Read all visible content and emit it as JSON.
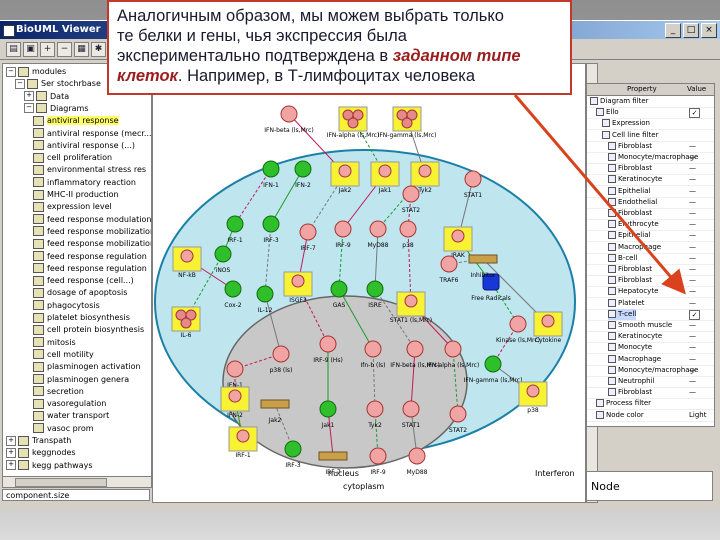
{
  "window": {
    "title": "BioUML Viewer",
    "controls": [
      "_",
      "□",
      "×"
    ]
  },
  "toolbar": {
    "buttons": [
      {
        "name": "open-icon",
        "glyph": "▤"
      },
      {
        "name": "save-icon",
        "glyph": "▣"
      },
      {
        "name": "zoom-in-icon",
        "glyph": "+"
      },
      {
        "name": "zoom-out-icon",
        "glyph": "−"
      },
      {
        "name": "layout-icon",
        "glyph": "▦"
      },
      {
        "name": "settings-icon",
        "glyph": "✱"
      },
      {
        "name": "help-icon",
        "glyph": "?"
      }
    ]
  },
  "callout": {
    "line1": "Аналогичным образом, мы можем выбрать только",
    "line2": "те белки и гены, чья экспрессия была",
    "line3_plain": "экспериментально подтверждена в ",
    "line3_emph": "заданном типе",
    "line4_emph": "клеток",
    "line4_plain": ". Например, в Т-лимфоцитах человека"
  },
  "tree": {
    "items": [
      {
        "label": "modules",
        "indent": 0,
        "exp": "−"
      },
      {
        "label": "Ser stochrbase",
        "indent": 1,
        "exp": "−"
      },
      {
        "label": "Data",
        "indent": 2,
        "exp": "+"
      },
      {
        "label": "Diagrams",
        "indent": 2,
        "exp": "−"
      },
      {
        "label": "antiviral response",
        "indent": 3,
        "exp": "",
        "selected": true
      },
      {
        "label": "antiviral response (mecr...)",
        "indent": 3,
        "exp": ""
      },
      {
        "label": "antiviral response (...)",
        "indent": 3,
        "exp": ""
      },
      {
        "label": "cell proliferation",
        "indent": 3,
        "exp": ""
      },
      {
        "label": "environmental stress res",
        "indent": 3,
        "exp": ""
      },
      {
        "label": "inflammatory reaction",
        "indent": 3,
        "exp": ""
      },
      {
        "label": "MHC-II production",
        "indent": 3,
        "exp": ""
      },
      {
        "label": "expression level",
        "indent": 3,
        "exp": ""
      },
      {
        "label": "feed response modulation...",
        "indent": 3,
        "exp": ""
      },
      {
        "label": "feed response mobilization..",
        "indent": 3,
        "exp": ""
      },
      {
        "label": "feed response mobilization",
        "indent": 3,
        "exp": ""
      },
      {
        "label": "feed response regulation",
        "indent": 3,
        "exp": ""
      },
      {
        "label": "feed response regulation",
        "indent": 3,
        "exp": ""
      },
      {
        "label": "feed response (cell...)",
        "indent": 3,
        "exp": ""
      },
      {
        "label": "dosage of apoptosis",
        "indent": 3,
        "exp": ""
      },
      {
        "label": "phagocytosis",
        "indent": 3,
        "exp": ""
      },
      {
        "label": "platelet biosynthesis",
        "indent": 3,
        "exp": ""
      },
      {
        "label": "cell protein biosynthesis",
        "indent": 3,
        "exp": ""
      },
      {
        "label": "mitosis",
        "indent": 3,
        "exp": ""
      },
      {
        "label": "cell motility",
        "indent": 3,
        "exp": ""
      },
      {
        "label": "plasminogen activation",
        "indent": 3,
        "exp": ""
      },
      {
        "label": "plasminogen genera",
        "indent": 3,
        "exp": ""
      },
      {
        "label": "secretion",
        "indent": 3,
        "exp": ""
      },
      {
        "label": "vasoregulation",
        "indent": 3,
        "exp": ""
      },
      {
        "label": "water transport",
        "indent": 3,
        "exp": ""
      },
      {
        "label": "vasoc prom",
        "indent": 3,
        "exp": ""
      },
      {
        "label": "Transpath",
        "indent": 0,
        "exp": "+"
      },
      {
        "label": "keggnodes",
        "indent": 0,
        "exp": "+"
      },
      {
        "label": "kegg pathways",
        "indent": 0,
        "exp": "+"
      }
    ],
    "size_field": "component.size"
  },
  "props": {
    "header_property": "Property",
    "header_value": "Value",
    "rows": [
      {
        "label": "Diagram filter",
        "indent": 0,
        "value": "",
        "checkbox": false
      },
      {
        "label": "Ello",
        "indent": 1,
        "value": "☑",
        "checkbox": true
      },
      {
        "label": "Expression",
        "indent": 2,
        "value": "",
        "checkbox": false
      },
      {
        "label": "Cell line filter",
        "indent": 2,
        "value": "",
        "checkbox": false
      },
      {
        "label": "Fibroblast",
        "indent": 3,
        "value": "—",
        "checkbox": false
      },
      {
        "label": "Monocyte/macrophage",
        "indent": 3,
        "value": "—",
        "checkbox": false
      },
      {
        "label": "Fibroblast",
        "indent": 3,
        "value": "—",
        "checkbox": false
      },
      {
        "label": "Keratinocyte",
        "indent": 3,
        "value": "—",
        "checkbox": false
      },
      {
        "label": "Epithelial",
        "indent": 3,
        "value": "—",
        "checkbox": false
      },
      {
        "label": "Endothelial",
        "indent": 3,
        "value": "—",
        "checkbox": false
      },
      {
        "label": "Fibroblast",
        "indent": 3,
        "value": "—",
        "checkbox": false
      },
      {
        "label": "Erythrocyte",
        "indent": 3,
        "value": "—",
        "checkbox": false
      },
      {
        "label": "Epithelial",
        "indent": 3,
        "value": "—",
        "checkbox": false
      },
      {
        "label": "Macrophage",
        "indent": 3,
        "value": "—",
        "checkbox": false
      },
      {
        "label": "B-cell",
        "indent": 3,
        "value": "—",
        "checkbox": false
      },
      {
        "label": "Fibroblast",
        "indent": 3,
        "value": "—",
        "checkbox": false
      },
      {
        "label": "Fibroblast",
        "indent": 3,
        "value": "—",
        "checkbox": false
      },
      {
        "label": "Hepatocyte",
        "indent": 3,
        "value": "—",
        "checkbox": false
      },
      {
        "label": "Platelet",
        "indent": 3,
        "value": "—",
        "checkbox": false
      },
      {
        "label": "T-cell",
        "indent": 3,
        "value": "☑",
        "checkbox": true,
        "highlight": true
      },
      {
        "label": "Smooth muscle",
        "indent": 3,
        "value": "—",
        "checkbox": false
      },
      {
        "label": "Keratinocyte",
        "indent": 3,
        "value": "—",
        "checkbox": false
      },
      {
        "label": "Monocyte",
        "indent": 3,
        "value": "—",
        "checkbox": false
      },
      {
        "label": "Macrophage",
        "indent": 3,
        "value": "—",
        "checkbox": false
      },
      {
        "label": "Monocyte/macrophage",
        "indent": 3,
        "value": "—",
        "checkbox": false
      },
      {
        "label": "Neutrophil",
        "indent": 3,
        "value": "—",
        "checkbox": false
      },
      {
        "label": "Fibroblast",
        "indent": 3,
        "value": "—",
        "checkbox": false
      },
      {
        "label": "Process filter",
        "indent": 1,
        "value": "",
        "checkbox": false
      },
      {
        "label": "Node color",
        "indent": 1,
        "value": "Light",
        "checkbox": false
      }
    ],
    "node_label": "Node"
  },
  "diagram": {
    "region_labels": {
      "cytoplasm": "cytoplasm",
      "nucleus": "nucleus",
      "membrane": "Interferon"
    },
    "node_labels": [
      "IFN-beta (ls,Mrc)",
      "IFN-alpha (ls,Mrc)",
      "IFN-gamma (ls,Mrc)",
      "IFN-1",
      "IFN-2",
      "Jak2",
      "Jak1",
      "Tyk2",
      "STAT1",
      "STAT2",
      "IRF-1",
      "IRF-3",
      "IRF-7",
      "IRF-9",
      "MyD88",
      "p38",
      "IRAK",
      "TRAF6",
      "NF-kB",
      "iNOS",
      "Cox-2",
      "IL-6",
      "IL-12",
      "ISGF3",
      "GAS",
      "ISRE",
      "STAT1 (ls,Mrc)",
      "Free Radicals",
      "Inhibitor",
      "Kinase (ls,Mrc)",
      "Cytokine",
      "p38 (ls)",
      "IRF-9 (Hs)",
      "Ifn-b (ls)"
    ]
  }
}
